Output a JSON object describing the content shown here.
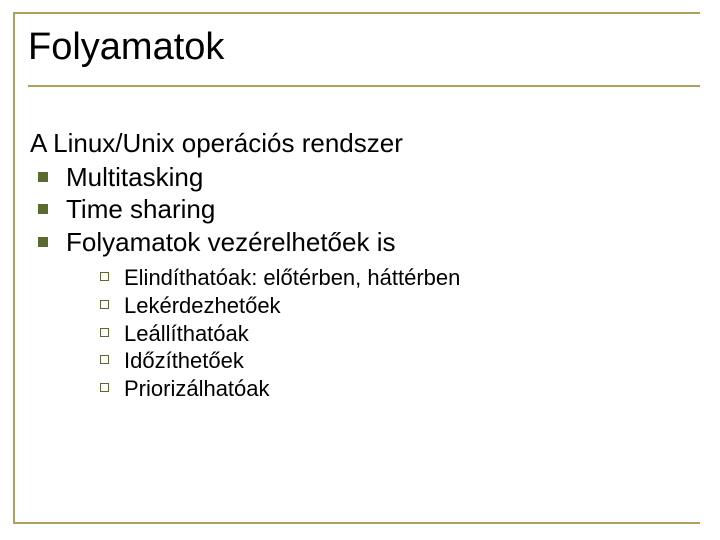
{
  "title": "Folyamatok",
  "intro": "A Linux/Unix operációs rendszer",
  "level1": [
    "Multitasking",
    "Time sharing",
    "Folyamatok vezérelhetőek is"
  ],
  "level2": [
    "Elindíthatóak: előtérben, háttérben",
    "Lekérdezhetőek",
    "Leállíthatóak",
    "Időzíthetőek",
    "Priorizálhatóak"
  ]
}
